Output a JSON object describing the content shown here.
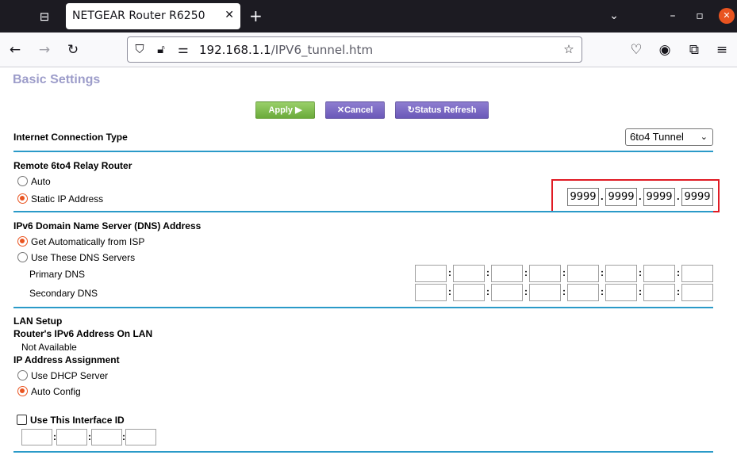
{
  "browser": {
    "tab_title": "NETGEAR Router R6250",
    "url_host": "192.168.1.1",
    "url_path": "/IPV6_tunnel.htm"
  },
  "page": {
    "title": "Basic Settings",
    "buttons": {
      "apply": "Apply ▶",
      "cancel": "Cancel",
      "status_refresh": "Status Refresh"
    },
    "internet_connection_type": {
      "label": "Internet Connection Type",
      "selected": "6to4 Tunnel"
    },
    "relay_router": {
      "heading": "Remote 6to4 Relay Router",
      "option_auto": "Auto",
      "option_static": "Static IP Address",
      "selected": "static",
      "ip": [
        "9999",
        "9999",
        "9999",
        "9999"
      ]
    },
    "dns": {
      "heading": "IPv6 Domain Name Server (DNS) Address",
      "option_auto": "Get Automatically from ISP",
      "option_manual": "Use These DNS Servers",
      "selected": "auto",
      "primary_label": "Primary DNS",
      "secondary_label": "Secondary DNS"
    },
    "lan": {
      "heading": "LAN Setup",
      "router_ipv6_label": "Router's IPv6 Address On LAN",
      "router_ipv6_value": "Not Available",
      "assignment_heading": "IP Address Assignment",
      "option_dhcp": "Use DHCP Server",
      "option_auto": "Auto Config",
      "selected": "auto",
      "interface_id_label": "Use This Interface ID",
      "interface_id_checked": false
    }
  },
  "colors": {
    "title": "#9d9dca",
    "separator": "#2a9ac8",
    "highlight": "#e01b24",
    "radio_accent": "#e95420"
  }
}
